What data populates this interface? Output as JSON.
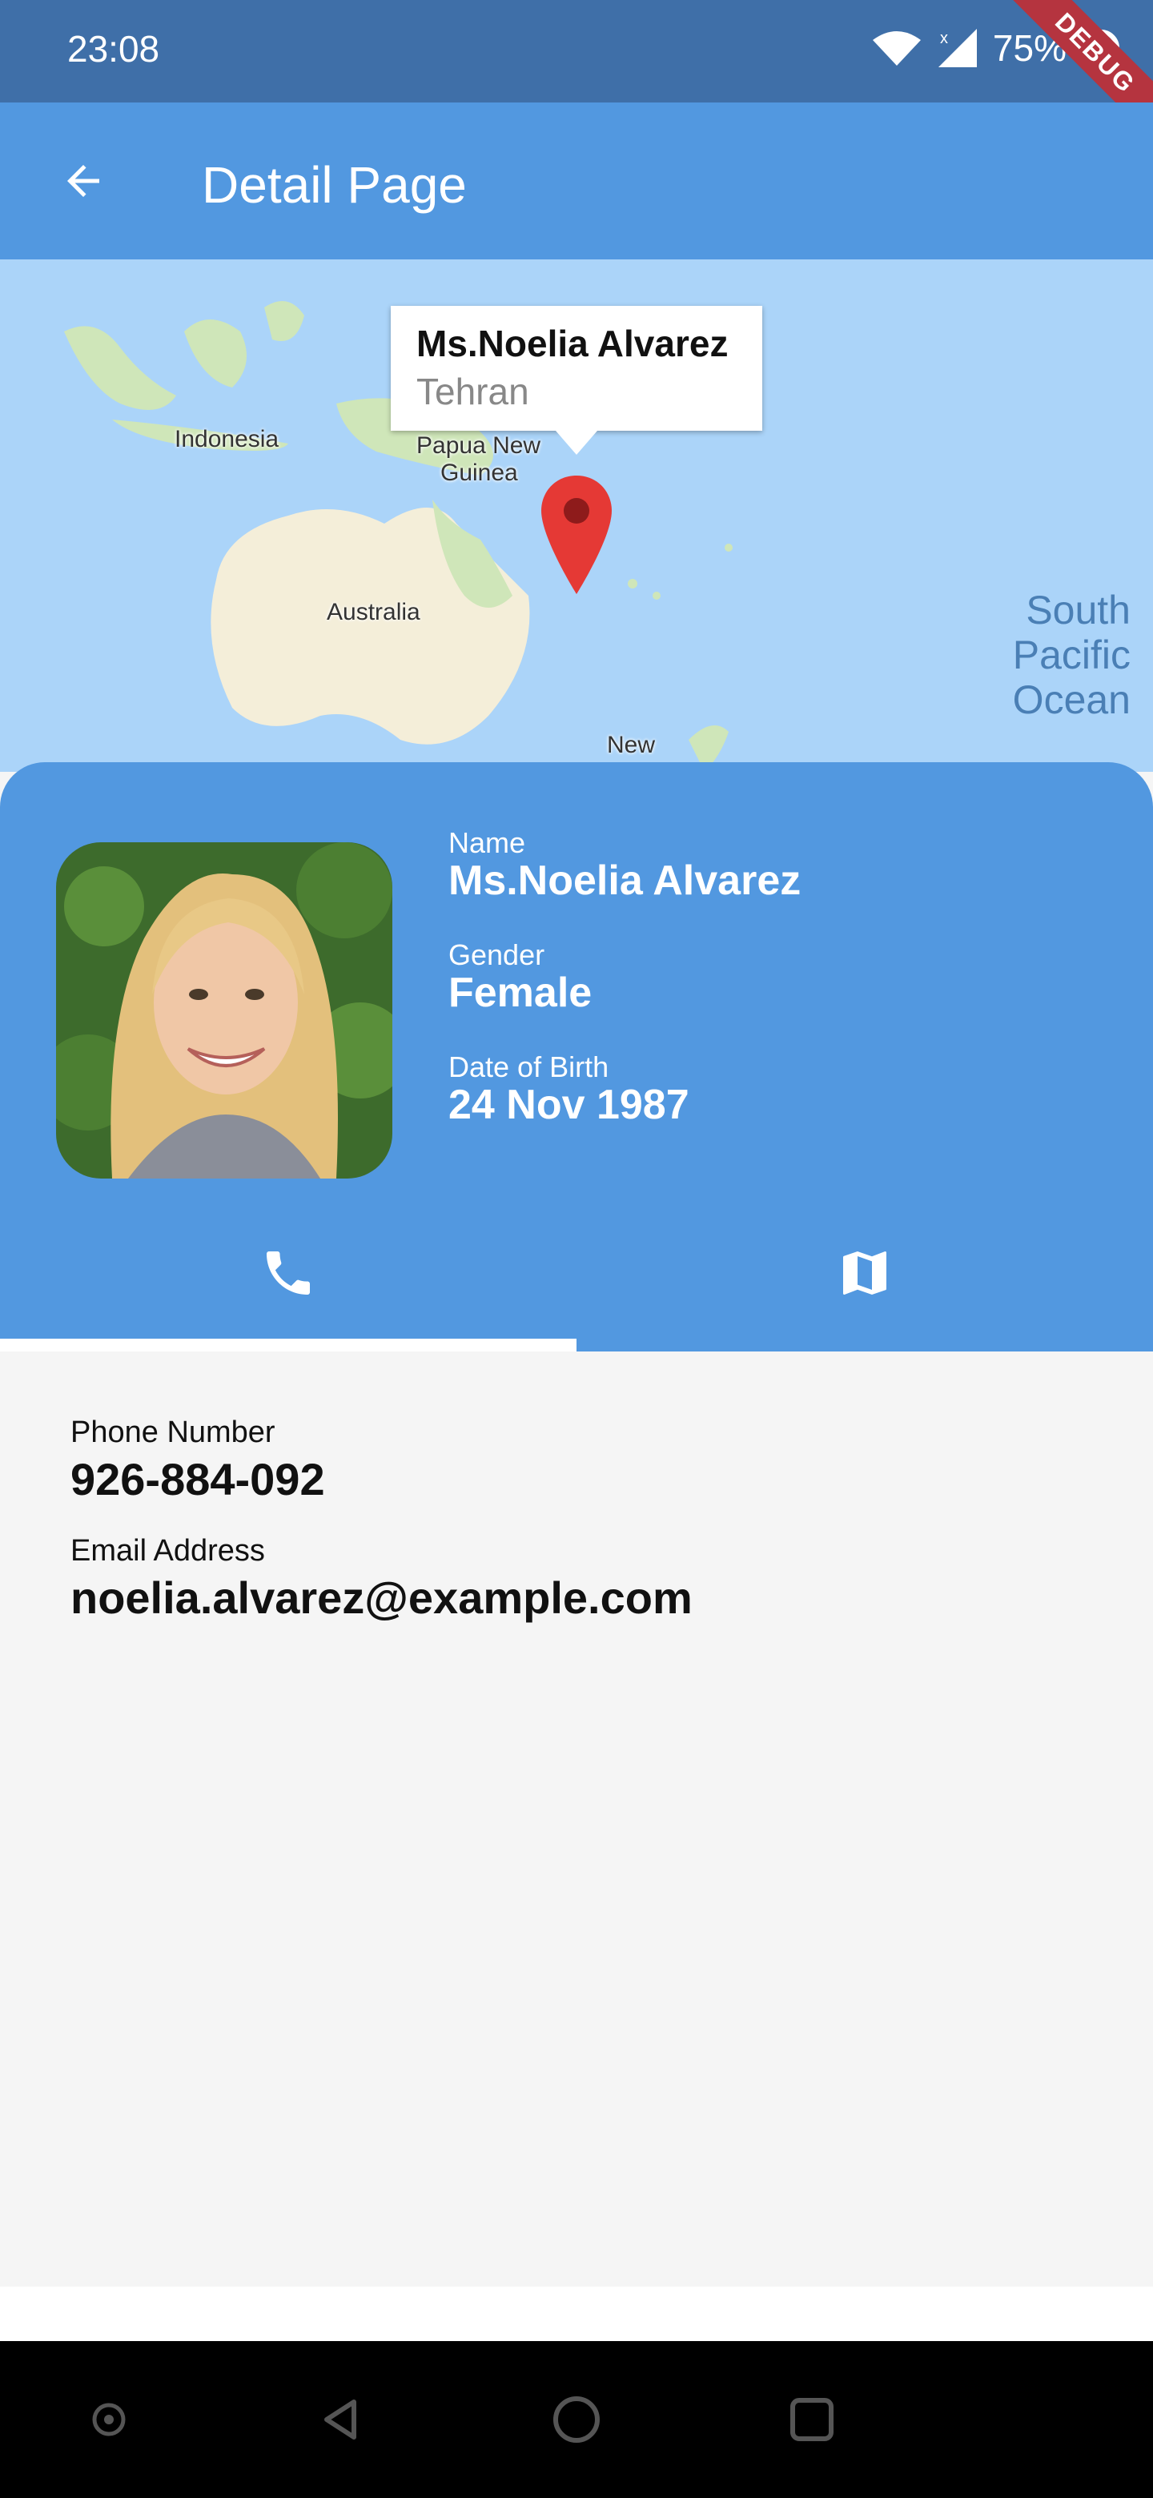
{
  "status_bar": {
    "time": "23:08",
    "battery": "75%",
    "debug_label": "DEBUG"
  },
  "app_bar": {
    "title": "Detail Page"
  },
  "map": {
    "labels": {
      "indonesia": "Indonesia",
      "png_line1": "Papua New",
      "png_line2": "Guinea",
      "australia": "Australia",
      "new_zealand": "New",
      "ocean_line1": "South",
      "ocean_line2": "Pacific",
      "ocean_line3": "Ocean"
    },
    "info_window": {
      "name": "Ms.Noelia Alvarez",
      "city": "Tehran"
    },
    "colors": {
      "water": "#abd4f9",
      "land": "#f4eed9",
      "forest": "#cfe6b9",
      "pin": "#e53935"
    }
  },
  "profile": {
    "name_label": "Name",
    "name": "Ms.Noelia Alvarez",
    "gender_label": "Gender",
    "gender": "Female",
    "dob_label": "Date of Birth",
    "dob": "24 Nov 1987"
  },
  "tabs": [
    {
      "icon": "phone-icon",
      "selected": true
    },
    {
      "icon": "map-icon",
      "selected": false
    }
  ],
  "contact": {
    "phone_label": "Phone Number",
    "phone": "926-884-092",
    "email_label": "Email Address",
    "email": "noelia.alvarez@example.com"
  },
  "colors": {
    "primary": "#5298e0",
    "status_bar": "#3f6fa8",
    "debug_banner": "#b5343f"
  }
}
